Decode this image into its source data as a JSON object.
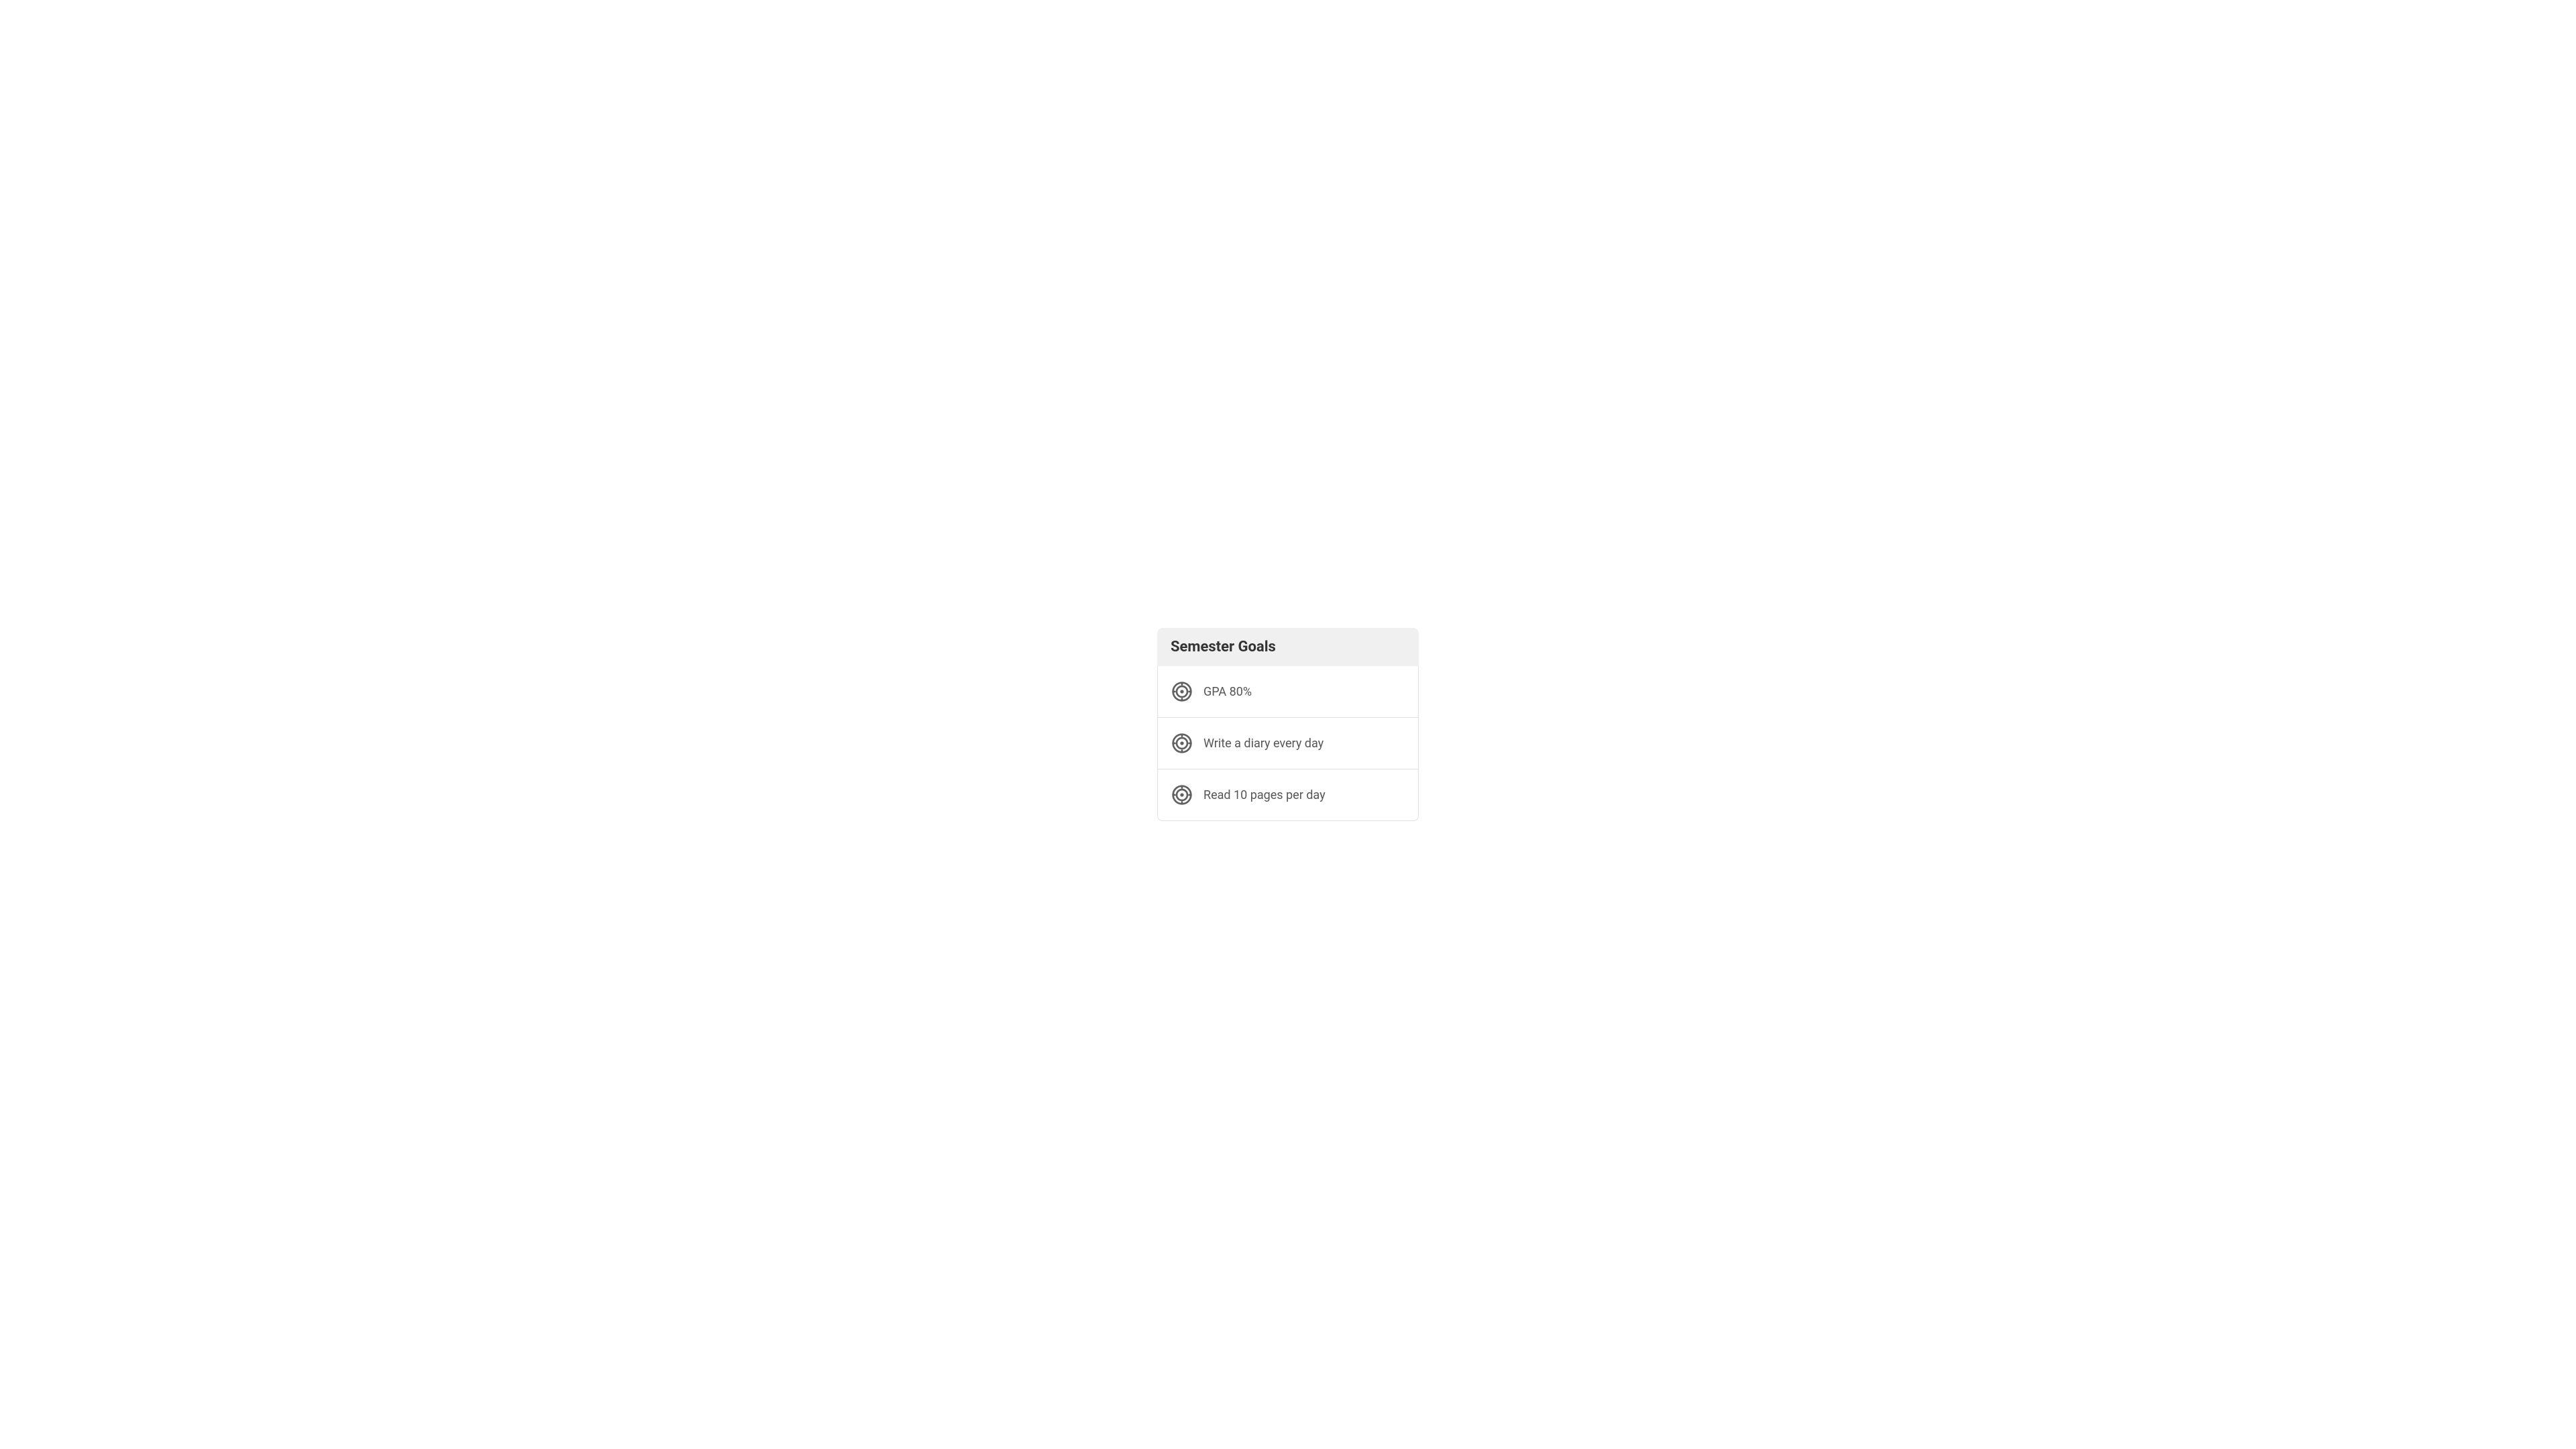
{
  "header": {
    "title": "Semester Goals"
  },
  "goals": [
    {
      "id": "goal-gpa",
      "text": "GPA 80%",
      "icon": "target-icon"
    },
    {
      "id": "goal-diary",
      "text": "Write a diary every day",
      "icon": "target-icon"
    },
    {
      "id": "goal-read",
      "text": "Read 10 pages per day",
      "icon": "target-icon"
    }
  ],
  "colors": {
    "header_bg": "#f0f0f0",
    "icon_color": "#606060",
    "text_color": "#555555",
    "title_color": "#333333",
    "border_color": "#e0e0e0",
    "bg": "#ffffff"
  }
}
